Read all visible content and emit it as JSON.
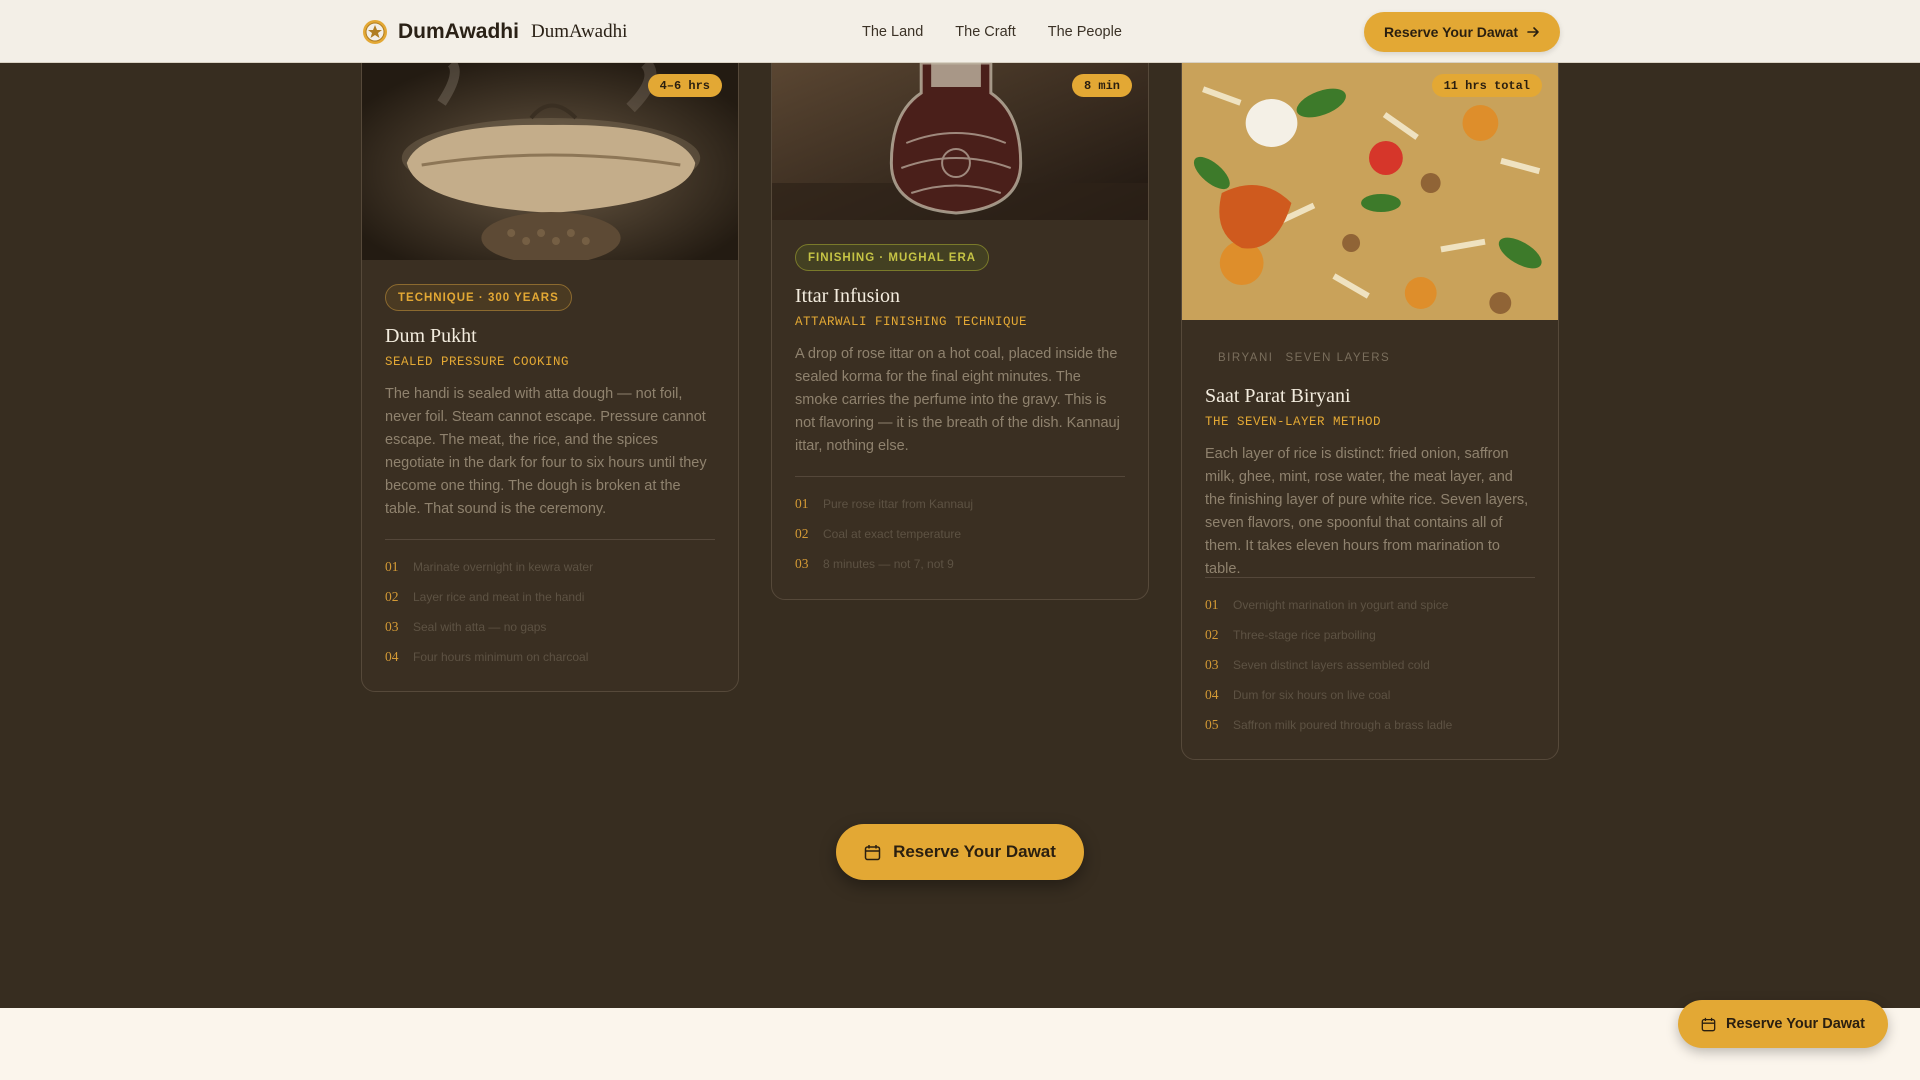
{
  "header": {
    "brand_name": "DumAwadhi",
    "brand_sub": "DumAwadhi",
    "nav": [
      "The Land",
      "The Craft",
      "The People"
    ],
    "cta_label": "Reserve Your Dawat"
  },
  "cards": [
    {
      "time_badge": "4–6 hrs",
      "tag": "TECHNIQUE · 300 YEARS",
      "title": "Dum Pukht",
      "subtitle": "SEALED PRESSURE COOKING",
      "body": "The handi is sealed with atta dough — not foil, never foil. Steam cannot escape. Pressure cannot escape. The meat, the rice, and the spices negotiate in the dark for four to six hours until they become one thing. The dough is broken at the table. That sound is the ceremony.",
      "steps": [
        {
          "num": "01",
          "text": "Marinate overnight in kewra water"
        },
        {
          "num": "02",
          "text": "Layer rice and meat in the handi"
        },
        {
          "num": "03",
          "text": "Seal with atta — no gaps"
        },
        {
          "num": "04",
          "text": "Four hours minimum on charcoal"
        }
      ]
    },
    {
      "time_badge": "8 min",
      "tag": "FINISHING · MUGHAL ERA",
      "title": "Ittar Infusion",
      "subtitle": "ATTARWALI FINISHING TECHNIQUE",
      "body": "A drop of rose ittar on a hot coal, placed inside the sealed korma for the final eight minutes. The smoke carries the perfume into the gravy. This is not flavoring — it is the breath of the dish. Kannauj ittar, nothing else.",
      "steps": [
        {
          "num": "01",
          "text": "Pure rose ittar from Kannauj"
        },
        {
          "num": "02",
          "text": "Coal at exact temperature"
        },
        {
          "num": "03",
          "text": "8 minutes — not 7, not 9"
        }
      ]
    },
    {
      "time_badge": "11 hrs total",
      "tag_parts": [
        "BIRYANI",
        "SEVEN LAYERS"
      ],
      "title": "Saat Parat Biryani",
      "subtitle": "THE SEVEN-LAYER METHOD",
      "body": "Each layer of rice is distinct: fried onion, saffron milk, ghee, mint, rose water, the meat layer, and the finishing layer of pure white rice. Seven layers, seven flavors, one spoonful that contains all of them. It takes eleven hours from marination to table.",
      "steps": [
        {
          "num": "01",
          "text": "Overnight marination in yogurt and spice"
        },
        {
          "num": "02",
          "text": "Three-stage rice parboiling"
        },
        {
          "num": "03",
          "text": "Seven distinct layers assembled cold"
        },
        {
          "num": "04",
          "text": "Dum for six hours on live coal"
        },
        {
          "num": "05",
          "text": "Saffron milk poured through a brass ladle"
        }
      ]
    }
  ],
  "cta": {
    "label": "Reserve Your Dawat"
  },
  "floating_cta": {
    "label": "Reserve Your Dawat"
  },
  "colors": {
    "accent": "#e3a834",
    "background": "#372d20",
    "header_bg": "#f3efe7",
    "card_bg": "#3a2f22"
  },
  "icons": {
    "logo": "emblem-icon",
    "header_cta": "arrow-right-icon",
    "cta": "calendar-icon"
  }
}
